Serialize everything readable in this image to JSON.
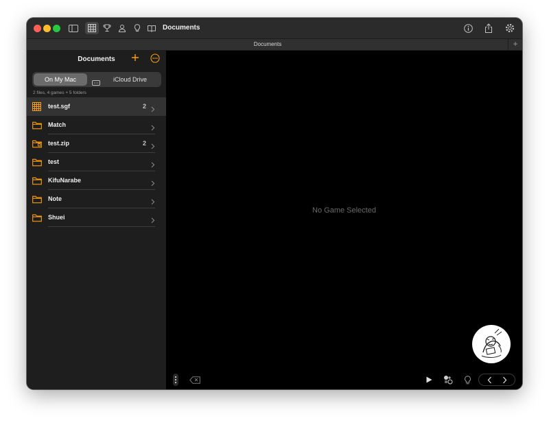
{
  "window": {
    "title": "Documents",
    "tab_label": "Documents",
    "tab_add": "+",
    "traffic_lights": {
      "close": "#ff5f57",
      "minimize": "#febc2e",
      "zoom": "#28c840"
    }
  },
  "toolbar": {
    "left_icons": [
      "sidebar-icon",
      "grid-icon",
      "trophy-icon",
      "user-icon",
      "lightbulb-icon",
      "book-icon"
    ],
    "right_icons": [
      "info-icon",
      "share-icon",
      "gear-icon"
    ]
  },
  "sidebar": {
    "title": "Documents",
    "accent": "#ff9f0a",
    "segment": {
      "selected": "On My Mac",
      "other": "iCloud Drive"
    },
    "summary": "2 files, 4 games + 5 folders",
    "items": [
      {
        "name": "test.sgf",
        "count": "2",
        "icon": "sgf-grid-icon"
      },
      {
        "name": "Match",
        "count": "",
        "icon": "folder-icon"
      },
      {
        "name": "test.zip",
        "count": "2",
        "icon": "zip-folder-icon"
      },
      {
        "name": "test",
        "count": "",
        "icon": "folder-icon"
      },
      {
        "name": "KifuNarabe",
        "count": "",
        "icon": "folder-icon"
      },
      {
        "name": "Note",
        "count": "",
        "icon": "folder-icon"
      },
      {
        "name": "Shuei",
        "count": "",
        "icon": "folder-icon"
      }
    ]
  },
  "content": {
    "placeholder": "No Game Selected"
  },
  "bottom_bar": {
    "icons": [
      "more-vertical-icon",
      "delete-icon",
      "play-icon",
      "analysis-icon",
      "hint-icon",
      "back-icon",
      "forward-icon"
    ]
  }
}
